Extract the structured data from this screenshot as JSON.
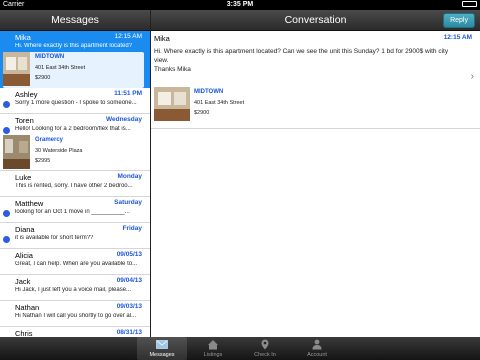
{
  "status_bar": {
    "carrier": "Carrier",
    "time": "3:35 PM",
    "battery_level": 1.0
  },
  "messages_panel": {
    "title": "Messages",
    "threads": [
      {
        "name": "Mika",
        "date": "12:15 AM",
        "preview": "Hi. Where exactly is this apartment located?",
        "unread": false,
        "selected": true,
        "listing": {
          "title": "MIDTOWN",
          "address": "401 East 34th Street",
          "price": "$2900"
        }
      },
      {
        "name": "Ashley",
        "date": "11:51 PM",
        "preview": "Sorry 1 more question - I spoke to someone...",
        "unread": true
      },
      {
        "name": "Toren",
        "date": "Wednesday",
        "preview": "Hello!  Looking for a 2 bedroom/flex that is...",
        "unread": true,
        "listing": {
          "title": "Gramercy",
          "address": "30 Waterside Plaza",
          "price": "$2995"
        }
      },
      {
        "name": "Luke",
        "date": "Monday",
        "preview": "This is rented, sorry.  I have other 2 bedroo...",
        "unread": false
      },
      {
        "name": "Matthew",
        "date": "Saturday",
        "preview": "looking for an Oct 1 move in  __________...",
        "unread": true
      },
      {
        "name": "Diana",
        "date": "Friday",
        "preview": "it is available for short term??",
        "unread": true
      },
      {
        "name": "Alicia",
        "date": "09/05/13",
        "preview": "Great, I can help. When are you available to...",
        "unread": false
      },
      {
        "name": "Jack",
        "date": "09/04/13",
        "preview": "Hi Jack,  I just left you a voice mail, please...",
        "unread": false
      },
      {
        "name": "Nathan",
        "date": "09/03/13",
        "preview": "Hi Nathan I will call you shortly to go over al...",
        "unread": false
      },
      {
        "name": "Chris",
        "date": "08/31/13",
        "preview": "",
        "unread": false
      }
    ]
  },
  "conversation": {
    "title": "Conversation",
    "reply_label": "Reply",
    "sender": "Mika",
    "time": "12:15 AM",
    "message": "Hi. Where exactly is this apartment located? Can we see the unit this Sunday? 1 bd for 2900$ with city view.",
    "signoff": "Thanks Mika",
    "listing": {
      "title": "MIDTOWN",
      "address": "401 East 34th Street",
      "price": "$2900"
    }
  },
  "tabbar": {
    "tabs": [
      {
        "label": "Messages",
        "icon": "envelope-icon",
        "active": true
      },
      {
        "label": "Listings",
        "icon": "house-icon",
        "active": false
      },
      {
        "label": "Check In",
        "icon": "map-pin-icon",
        "active": false
      },
      {
        "label": "Account",
        "icon": "person-icon",
        "active": false
      }
    ]
  },
  "colors": {
    "accent": "#1a8cf0",
    "link": "#1a56db",
    "unread_dot": "#2d5be3",
    "header": "#3a3a3a"
  }
}
